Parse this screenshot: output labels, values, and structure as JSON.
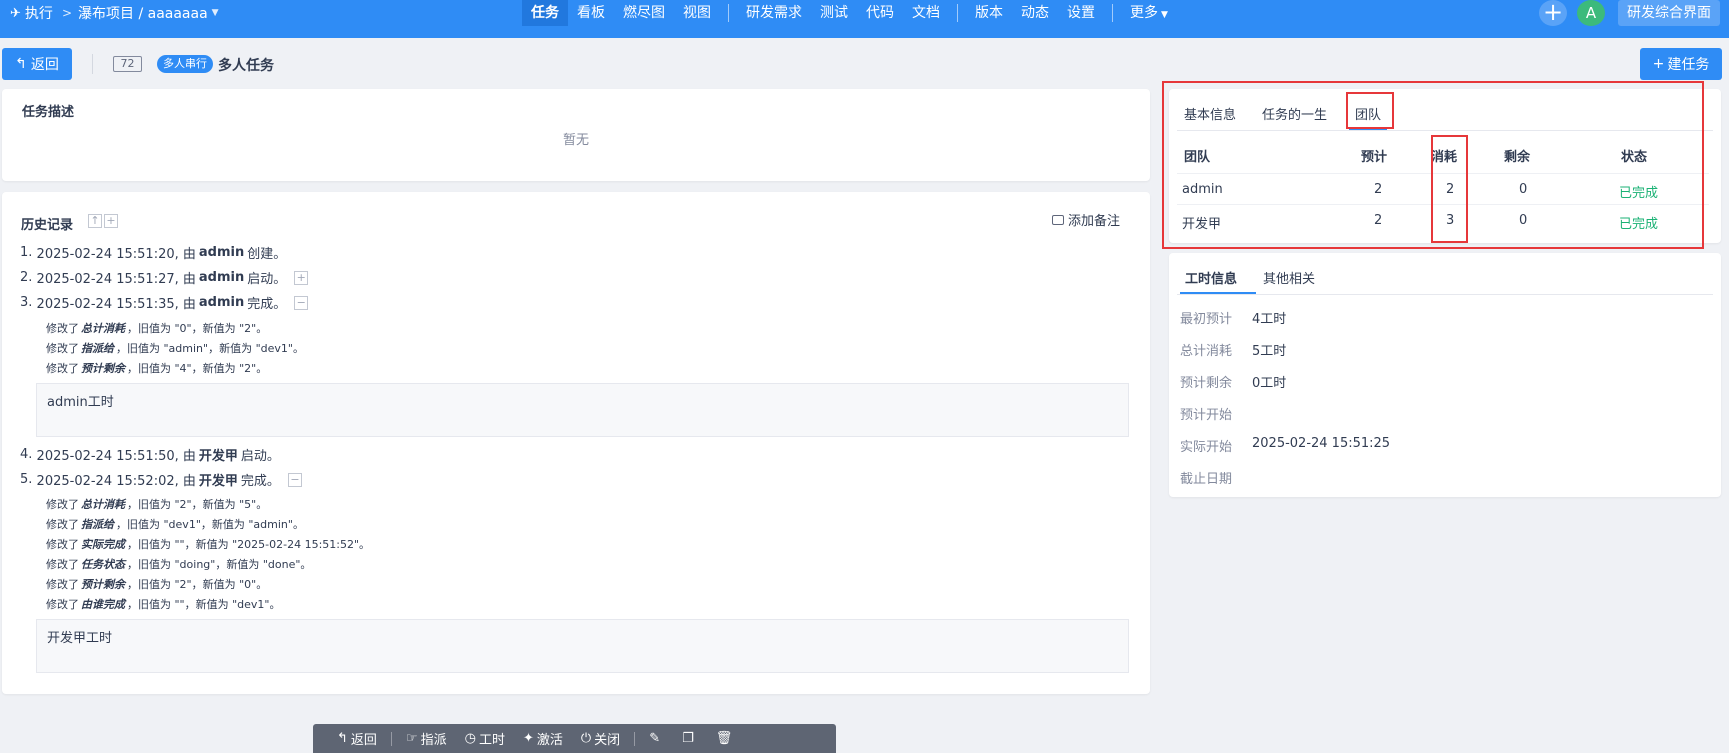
{
  "topbar": {
    "app_label": "执行",
    "separator": ">",
    "project_label": "瀑布项目 / aaaaaaa",
    "nav": [
      "任务",
      "看板",
      "燃尽图",
      "视图",
      "研发需求",
      "测试",
      "代码",
      "文档",
      "版本",
      "动态",
      "设置",
      "更多"
    ],
    "avatar_letter": "A",
    "ui_switch_label": "研发综合界面",
    "accent": "#2f8cf5"
  },
  "title": {
    "back_label": "返回",
    "task_id": "72",
    "mode_badge": "多人串行",
    "task_name": "多人任务",
    "create_label": "建任务"
  },
  "description": {
    "title": "任务描述",
    "empty": "暂无"
  },
  "history": {
    "title": "历史记录",
    "add_note": "添加备注",
    "entries": [
      {
        "num": "1.",
        "time": "2025-02-24 15:51:20, 由",
        "user": "admin",
        "action": "创建。"
      },
      {
        "num": "2.",
        "time": "2025-02-24 15:51:27, 由",
        "user": "admin",
        "action": "启动。"
      },
      {
        "num": "3.",
        "time": "2025-02-24 15:51:35, 由",
        "user": "admin",
        "action": "完成。"
      },
      {
        "num": "4.",
        "time": "2025-02-24 15:51:50, 由",
        "user": "开发甲",
        "action": "启动。"
      },
      {
        "num": "5.",
        "time": "2025-02-24 15:52:02, 由",
        "user": "开发甲",
        "action": "完成。"
      }
    ],
    "changes3": [
      {
        "pre": "修改了",
        "field": "总计消耗",
        "post": "，旧值为 \"0\"，新值为 \"2\"。"
      },
      {
        "pre": "修改了",
        "field": "指派给",
        "post": "，旧值为 \"admin\"，新值为 \"dev1\"。"
      },
      {
        "pre": "修改了",
        "field": "预计剩余",
        "post": "，旧值为 \"4\"，新值为 \"2\"。"
      }
    ],
    "comment3": "admin工时",
    "changes5": [
      {
        "pre": "修改了",
        "field": "总计消耗",
        "post": "，旧值为 \"2\"，新值为 \"5\"。"
      },
      {
        "pre": "修改了",
        "field": "指派给",
        "post": "，旧值为 \"dev1\"，新值为 \"admin\"。"
      },
      {
        "pre": "修改了",
        "field": "实际完成",
        "post": "，旧值为 \"\"，新值为 \"2025-02-24 15:51:52\"。"
      },
      {
        "pre": "修改了",
        "field": "任务状态",
        "post": "，旧值为 \"doing\"，新值为 \"done\"。"
      },
      {
        "pre": "修改了",
        "field": "预计剩余",
        "post": "，旧值为 \"2\"，新值为 \"0\"。"
      },
      {
        "pre": "修改了",
        "field": "由谁完成",
        "post": "，旧值为 \"\"，新值为 \"dev1\"。"
      }
    ],
    "comment5": "开发甲工时"
  },
  "team": {
    "tabs": [
      "基本信息",
      "任务的一生",
      "团队"
    ],
    "headers": [
      "团队",
      "预计",
      "消耗",
      "剩余",
      "状态"
    ],
    "rows": [
      [
        "admin",
        "2",
        "2",
        "0",
        "已完成"
      ],
      [
        "开发甲",
        "2",
        "3",
        "0",
        "已完成"
      ]
    ],
    "status_color": "#1bb275",
    "highlight_color": "#e6373a"
  },
  "hours": {
    "tabs": [
      "工时信息",
      "其他相关"
    ],
    "items": [
      {
        "key": "最初预计",
        "val": "4工时"
      },
      {
        "key": "总计消耗",
        "val": "5工时"
      },
      {
        "key": "预计剩余",
        "val": "0工时"
      },
      {
        "key": "预计开始",
        "val": ""
      },
      {
        "key": "实际开始",
        "val": "2025-02-24 15:51:25"
      },
      {
        "key": "截止日期",
        "val": ""
      }
    ]
  },
  "toolbar": {
    "back": "返回",
    "assign": "指派",
    "hours": "工时",
    "activate": "激活",
    "close": "关闭"
  }
}
